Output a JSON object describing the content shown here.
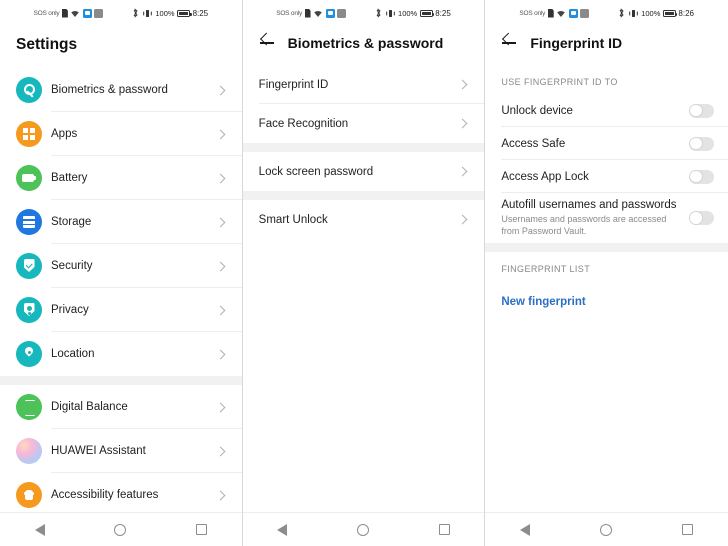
{
  "statusbar": {
    "sos": "SOS only",
    "battery_pct": "100%",
    "time_1": "8:25",
    "time_2": "8:25",
    "time_3": "8:26",
    "icons": [
      "sim-icon",
      "wifi-icon",
      "blue-app-icon",
      "gray-app-icon",
      "bluetooth-icon",
      "vibrate-icon",
      "battery-icon"
    ]
  },
  "panel1": {
    "title": "Settings",
    "groups": [
      {
        "items": [
          {
            "label": "Biometrics & password",
            "icon": "key-icon",
            "color": "#17b8bd"
          },
          {
            "label": "Apps",
            "icon": "apps-grid-icon",
            "color": "#f59a1e"
          },
          {
            "label": "Battery",
            "icon": "battery-icon",
            "color": "#4cc259"
          },
          {
            "label": "Storage",
            "icon": "storage-icon",
            "color": "#1e78e0"
          },
          {
            "label": "Security",
            "icon": "shield-check-icon",
            "color": "#17b8bd"
          },
          {
            "label": "Privacy",
            "icon": "shield-person-icon",
            "color": "#17b8bd"
          },
          {
            "label": "Location",
            "icon": "location-pin-icon",
            "color": "#17b8bd"
          }
        ]
      },
      {
        "items": [
          {
            "label": "Digital Balance",
            "icon": "hourglass-icon",
            "color": "#4cc259"
          },
          {
            "label": "HUAWEI Assistant",
            "icon": "assistant-sphere-icon",
            "color": "gradient"
          },
          {
            "label": "Accessibility features",
            "icon": "hand-icon",
            "color": "#f59a1e"
          }
        ]
      }
    ]
  },
  "panel2": {
    "title": "Biometrics & password",
    "back": "back-arrow-icon",
    "groups": [
      {
        "items": [
          {
            "label": "Fingerprint ID"
          },
          {
            "label": "Face Recognition"
          }
        ]
      },
      {
        "items": [
          {
            "label": "Lock screen password"
          }
        ]
      },
      {
        "items": [
          {
            "label": "Smart Unlock"
          }
        ]
      }
    ]
  },
  "panel3": {
    "title": "Fingerprint ID",
    "back": "back-arrow-icon",
    "section1_label": "USE FINGERPRINT ID TO",
    "toggles": [
      {
        "title": "Unlock device",
        "subtitle": "",
        "state": "off"
      },
      {
        "title": "Access Safe",
        "subtitle": "",
        "state": "off"
      },
      {
        "title": "Access App Lock",
        "subtitle": "",
        "state": "off"
      },
      {
        "title": "Autofill usernames and passwords",
        "subtitle": "Usernames and passwords are accessed from Password Vault.",
        "state": "off"
      }
    ],
    "section2_label": "FINGERPRINT LIST",
    "new_fingerprint": "New fingerprint",
    "link_color": "#2b6fc4"
  },
  "navbar": {
    "back": "nav-back-icon",
    "home": "nav-home-icon",
    "recents": "nav-recents-icon"
  }
}
